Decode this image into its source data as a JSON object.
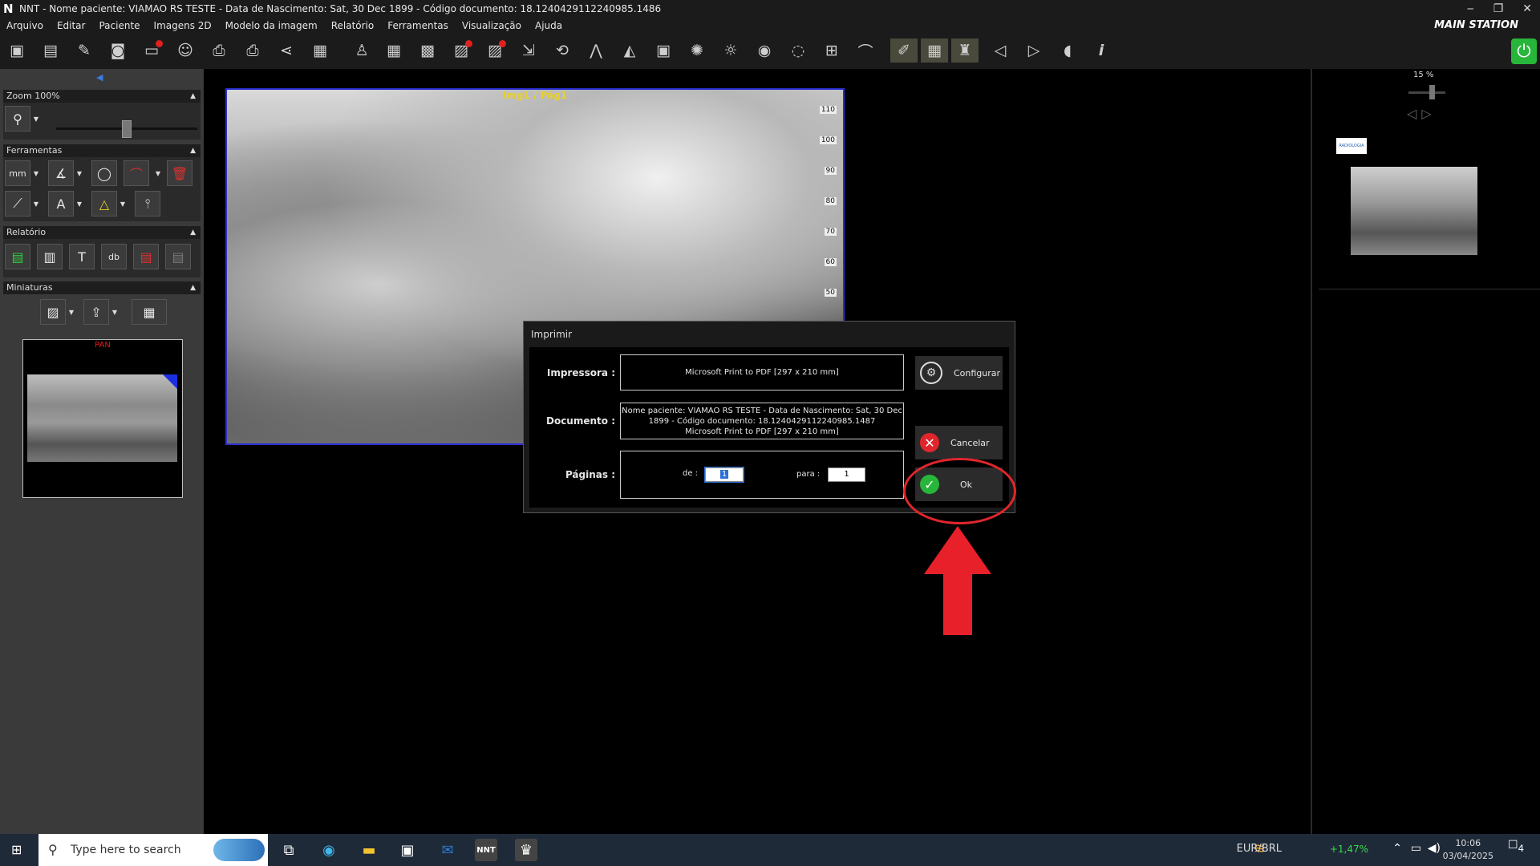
{
  "titlebar": {
    "logo": "N",
    "title": "NNT - Nome paciente: VIAMAO RS TESTE - Data de Nascimento: Sat, 30 Dec 1899 - Código documento: 18.1240429112240985.1486",
    "buttons": [
      "‒",
      "❐",
      "✕"
    ]
  },
  "menubar": {
    "items": [
      "Arquivo",
      "Editar",
      "Paciente",
      "Imagens 2D",
      "Modelo da imagem",
      "Relatório",
      "Ferramentas",
      "Visualização",
      "Ajuda"
    ],
    "station": "MAIN STATION"
  },
  "toolbar": {
    "icons": [
      "save-icon",
      "save-as-icon",
      "edit-document-icon",
      "camera-icon",
      "close-folder-icon",
      "patient-icon",
      "scan-icon",
      "print-icon",
      "share-icon",
      "layout-icon",
      "person-icon",
      "grid-icon",
      "grid-x-icon",
      "image-delete-icon",
      "images-delete-icon",
      "import-icon",
      "image-rotate-icon",
      "tooth-arch-icon",
      "ceph-icon",
      "image-icon",
      "brightness-icon",
      "contrast-icon",
      "visibility-icon",
      "sensor-icon",
      "measure-icon",
      "curve-icon",
      "implant-icon",
      "tooth-icon",
      "highlight-icon",
      "tooth-grid-icon",
      "prev-icon",
      "next-icon",
      "mouse-icon",
      "info-icon"
    ]
  },
  "left_panel": {
    "zoom_header": "Zoom 100%",
    "tools_header": "Ferramentas",
    "tool_text_mm": "mm",
    "tool_text_a": "A",
    "report_header": "Relatório",
    "report_db": "db",
    "thumbs_header": "Miniaturas",
    "thumb_label": "PAN"
  },
  "viewer": {
    "image_title": "Img1 / Pág1",
    "ruler_ticks": [
      "110",
      "100",
      "90",
      "80",
      "70",
      "60",
      "50"
    ]
  },
  "right_panel": {
    "zoom_percent": "15 %",
    "logo_text": "RADIOLOGIA"
  },
  "dialog": {
    "title": "Imprimir",
    "printer_label": "Impressora :",
    "printer_value": "Microsoft Print to PDF [297 x 210 mm]",
    "document_label": "Documento :",
    "document_line1": "Nome paciente: VIAMAO RS TESTE - Data de Nascimento: Sat, 30 Dec",
    "document_line2": "1899 - Código documento: 18.1240429112240985.1487",
    "document_line3": "Microsoft Print to PDF [297 x 210 mm]",
    "pages_label": "Páginas :",
    "from_label": "de :",
    "from_value": "1",
    "to_label": "para :",
    "to_value": "1",
    "configure_label": "Configurar",
    "cancel_label": "Cancelar",
    "ok_label": "Ok"
  },
  "colors": {
    "accent_green": "#27b53a",
    "cancel_red": "#e0262c",
    "annotation_red": "#e0262c",
    "xray_border": "#2a2fd0"
  },
  "taskbar": {
    "search_placeholder": "Type here to search",
    "currency": "EUR/BRL",
    "currency_change": "+1,47%",
    "time": "10:06",
    "date": "03/04/2025",
    "notifications": "4"
  }
}
